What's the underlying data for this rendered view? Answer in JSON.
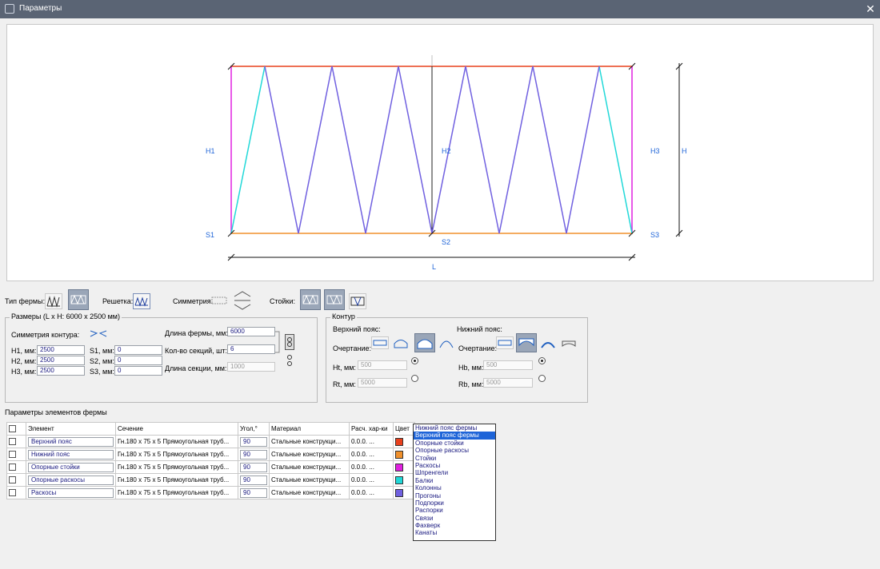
{
  "window": {
    "title": "Параметры"
  },
  "diagram": {
    "label_h1": "H1",
    "label_h2": "H2",
    "label_h3": "H3",
    "label_h": "H",
    "label_s1": "S1",
    "label_s2": "S2",
    "label_s3": "S3",
    "label_l": "L"
  },
  "toolbar": {
    "truss_type_label": "Тип фермы:",
    "lattice_label": "Решетка:",
    "symmetry_label": "Симметрия:",
    "posts_label": "Стойки:"
  },
  "sizes": {
    "title": "Размеры  (L x H: 6000 x 2500 мм)",
    "contour_symmetry_label": "Симметрия контура:",
    "h1": {
      "label": "H1, мм:",
      "value": "2500"
    },
    "h2": {
      "label": "H2, мм:",
      "value": "2500"
    },
    "h3": {
      "label": "H3, мм:",
      "value": "2500"
    },
    "s1": {
      "label": "S1, мм:",
      "value": "0"
    },
    "s2": {
      "label": "S2, мм:",
      "value": "0"
    },
    "s3": {
      "label": "S3, мм:",
      "value": "0"
    },
    "truss_length": {
      "label": "Длина фермы, мм:",
      "value": "6000"
    },
    "section_count": {
      "label": "Кол-во секций, шт:",
      "value": "6"
    },
    "section_length": {
      "label": "Длина секции, мм:",
      "value": "1000"
    }
  },
  "contour": {
    "title": "Контур",
    "top_chord_label": "Верхний пояс:",
    "bottom_chord_label": "Нижний пояс:",
    "outline_label_top": "Очертание:",
    "outline_label_bottom": "Очертание:",
    "ht": {
      "label": "Ht, мм:",
      "value": "500"
    },
    "rt": {
      "label": "Rt, мм:",
      "value": "5000"
    },
    "hb": {
      "label": "Hb, мм:",
      "value": "500"
    },
    "rb": {
      "label": "Rb, мм:",
      "value": "5000"
    }
  },
  "elements": {
    "title": "Параметры элементов фермы",
    "headers": [
      "",
      "Элемент",
      "Сечение",
      "Угол,°",
      "Материал",
      "Расч. хар-ки",
      "Цвет"
    ],
    "rows": [
      {
        "element": "Верхний пояс",
        "section": "Гн.180 x 75 x 5 Прямоугольная труб...",
        "angle": "90",
        "material": "Стальные конструкци...",
        "calc": "0.0.0.",
        "color": "#e8401c"
      },
      {
        "element": "Нижний пояс",
        "section": "Гн.180 x 75 x 5 Прямоугольная труб...",
        "angle": "90",
        "material": "Стальные конструкци...",
        "calc": "0.0.0.",
        "color": "#f0902c"
      },
      {
        "element": "Опорные стойки",
        "section": "Гн.180 x 75 x 5 Прямоугольная труб...",
        "angle": "90",
        "material": "Стальные конструкци...",
        "calc": "0.0.0.",
        "color": "#e020e0"
      },
      {
        "element": "Опорные раскосы",
        "section": "Гн.180 x 75 x 5 Прямоугольная труб...",
        "angle": "90",
        "material": "Стальные конструкци...",
        "calc": "0.0.0.",
        "color": "#20d8d8"
      },
      {
        "element": "Раскосы",
        "section": "Гн.180 x 75 x 5 Прямоугольная труб...",
        "angle": "90",
        "material": "Стальные конструкци...",
        "calc": "0.0.0.",
        "color": "#7060e0"
      }
    ],
    "ellipsis": "..."
  },
  "dropdown": {
    "selected_index": 1,
    "items": [
      "Нижний пояс фермы",
      "Верхний пояс фермы",
      "Опорные стойки",
      "Опорные раскосы",
      "Стойки",
      "Раскосы",
      "Шпренгели",
      "Балки",
      "Колонны",
      "Прогоны",
      "Подпорки",
      "Распорки",
      "Связи",
      "Фахверк",
      "Канаты"
    ]
  },
  "colors": {
    "top_chord": "#e8401c",
    "bottom_chord": "#f0902c",
    "posts": "#e020e0",
    "support_braces": "#20d8d8",
    "braces": "#7060e0",
    "label_blue": "#1e64d8"
  }
}
